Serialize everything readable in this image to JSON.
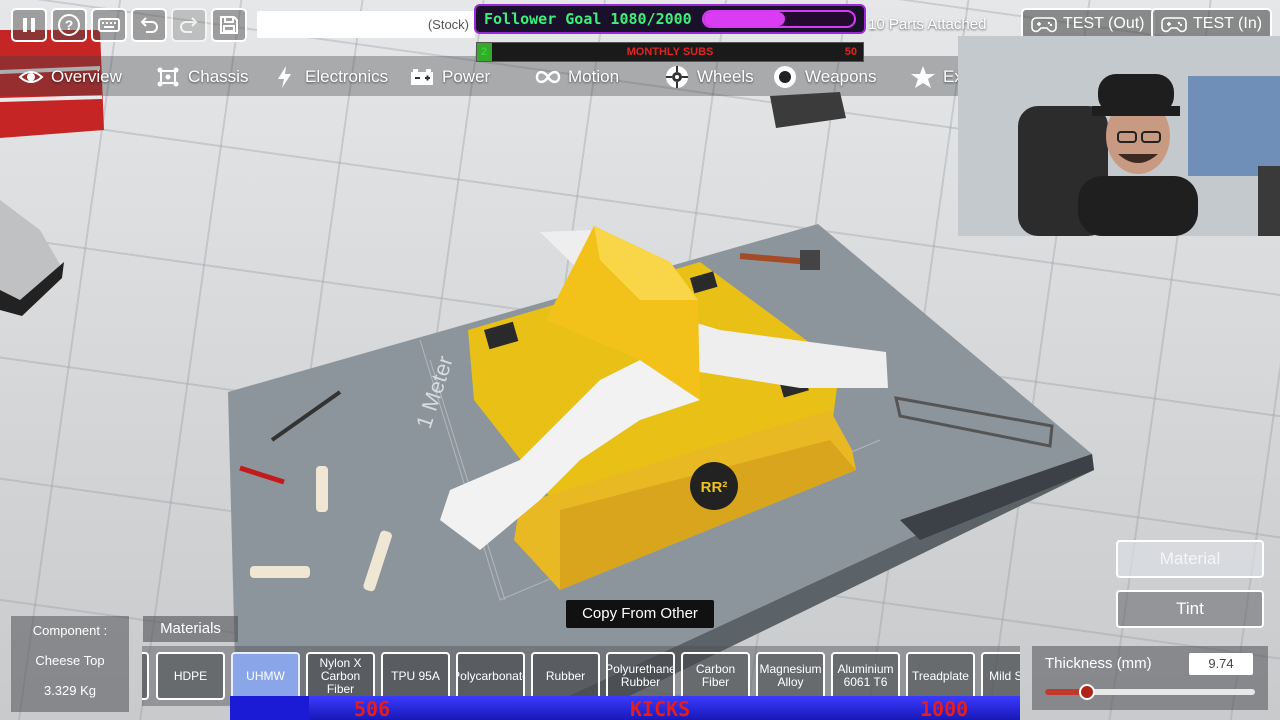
{
  "toolbar": {
    "buttons": [
      {
        "name": "pause-button",
        "icon": "pause-icon"
      },
      {
        "name": "help-button",
        "icon": "question-icon"
      },
      {
        "name": "keyboard-button",
        "icon": "keyboard-icon"
      },
      {
        "name": "undo-button",
        "icon": "undo-icon"
      },
      {
        "name": "redo-button",
        "icon": "redo-icon"
      },
      {
        "name": "save-button",
        "icon": "save-icon"
      }
    ],
    "stock_text": "(Stock)",
    "parts_attached": "10 Parts Attached",
    "test_out": "TEST (Out)",
    "test_in": "TEST (In)"
  },
  "overlays": {
    "follower_goal": {
      "label": "Follower Goal 1080/2000",
      "current": 1080,
      "target": 2000,
      "fill_color": "#d93cf2"
    },
    "monthly_subs": {
      "label": "MONTHLY SUBS",
      "current": "2",
      "max": "50",
      "fraction": 0.04
    },
    "kicks": {
      "current": "506",
      "label": "KICKS",
      "max": "1000",
      "fraction": 0.1
    }
  },
  "tabs": [
    {
      "label": "Overview",
      "icon": "eye-icon"
    },
    {
      "label": "Chassis",
      "icon": "chassis-icon"
    },
    {
      "label": "Electronics",
      "icon": "lightning-icon"
    },
    {
      "label": "Power",
      "icon": "battery-icon"
    },
    {
      "label": "Motion",
      "icon": "infinity-icon"
    },
    {
      "label": "Wheels",
      "icon": "wheel-icon"
    },
    {
      "label": "Weapons",
      "icon": "weapon-icon"
    },
    {
      "label": "Ex",
      "icon": "star-icon"
    }
  ],
  "viewport": {
    "grid_label": "1 Meter",
    "logo_text": "RR²"
  },
  "component": {
    "label": "Component :",
    "name": "Cheese Top",
    "weight": "3.329 Kg"
  },
  "materials": {
    "tab_label": "Materials",
    "items": [
      "HDPE",
      "UHMW",
      "Nylon X Carbon Fiber",
      "TPU 95A",
      "Polycarbonate",
      "Rubber",
      "Polyurethane Rubber",
      "Carbon Fiber",
      "Magnesium Alloy",
      "Aluminium 6061 T6",
      "Treadplate",
      "Mild Steel"
    ],
    "selected": "UHMW"
  },
  "copy_button": "Copy From Other",
  "side_buttons": {
    "material": "Material",
    "tint": "Tint"
  },
  "thickness": {
    "label": "Thickness (mm)",
    "value": "9.74",
    "fraction": 0.2
  },
  "colors": {
    "accent_green": "#3ef07a",
    "chassis_yellow": "#f2c21a",
    "selected_material": "#8aa6e8"
  }
}
